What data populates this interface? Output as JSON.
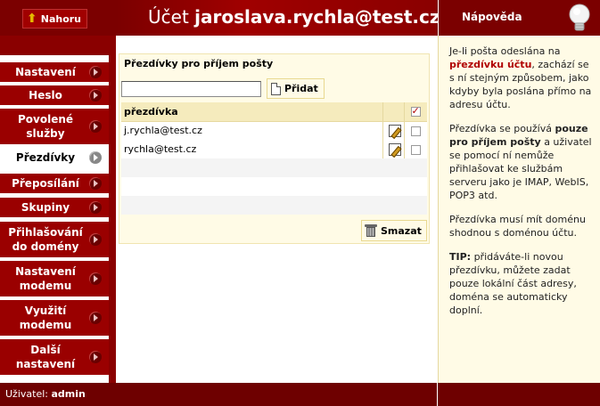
{
  "header": {
    "up_label": "Nahoru",
    "title_prefix": "Účet",
    "title_account": "jaroslava.rychla@test.cz",
    "help_title": "Nápověda"
  },
  "sidebar": {
    "items": [
      {
        "label": "Nastavení"
      },
      {
        "label": "Heslo"
      },
      {
        "label": "Povolené služby"
      },
      {
        "label": "Přezdívky",
        "active": true
      },
      {
        "label": "Přeposílání"
      },
      {
        "label": "Skupiny"
      },
      {
        "label": "Přihlašování do domény"
      },
      {
        "label": "Nastavení modemu"
      },
      {
        "label": "Využití modemu"
      },
      {
        "label": "Další nastavení"
      }
    ]
  },
  "main": {
    "panel_title": "Přezdívky pro příjem pošty",
    "input_value": "",
    "add_label": "Přidat",
    "table": {
      "header": "přezdívka",
      "rows": [
        "j.rychla@test.cz",
        "rychla@test.cz",
        "",
        "",
        ""
      ]
    },
    "delete_label": "Smazat"
  },
  "help": {
    "p1_a": "Je-li pošta odeslána na",
    "p1_red": "přezdívku účtu",
    "p1_b": ", zachází se s ní stejným způsobem, jako kdyby byla poslána přímo na adresu účtu.",
    "p2_a": "Přezdívka se používá",
    "p2_bold": "pouze pro příjem pošty",
    "p2_b": "a uživatel se pomocí ní nemůže přihlašovat ke službám serveru jako je IMAP, WebIS, POP3 atd.",
    "p3": "Přezdívka musí mít doménu shodnou s doménou účtu.",
    "p4_bold": "TIP:",
    "p4": "přidáváte-li novou přezdívku, můžete zadat pouze lokální část adresy, doména se automaticky doplní."
  },
  "footer": {
    "user_prefix": "Uživatel:",
    "user_name": "admin"
  },
  "colors": {
    "brand": "#7b0000",
    "nav": "#9a0000",
    "panel_bg": "#fffbe6",
    "accent_red_text": "#b00000"
  }
}
